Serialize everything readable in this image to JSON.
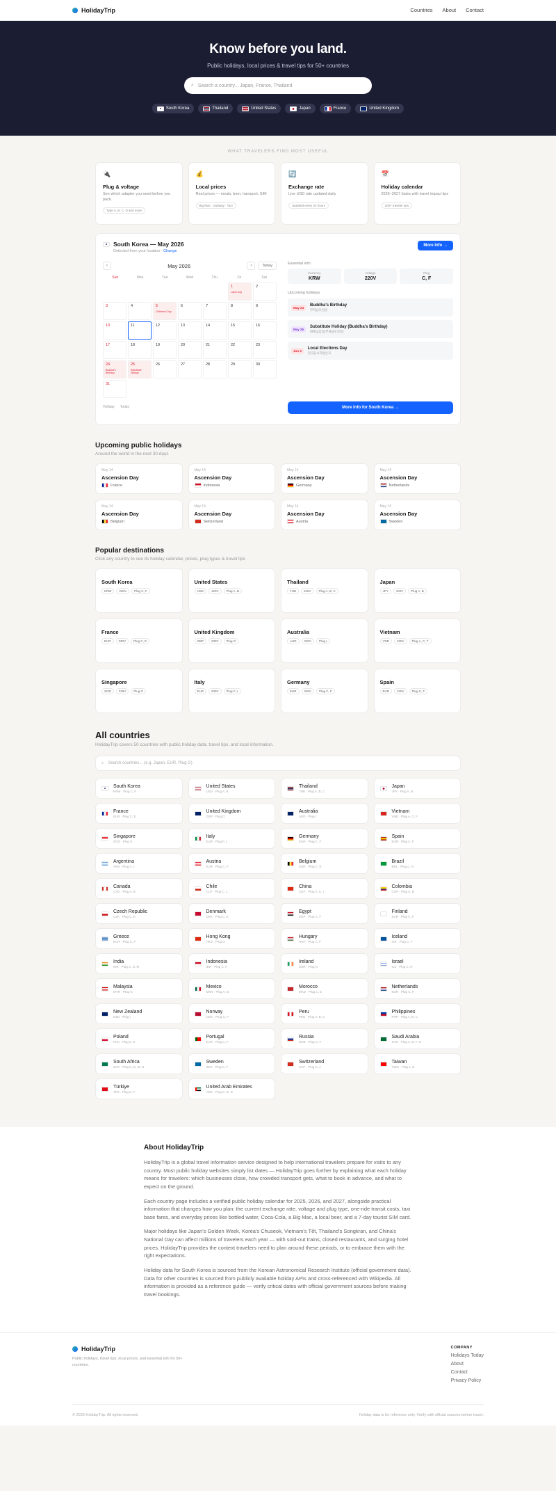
{
  "nav": {
    "brand": "HolidayTrip",
    "links": [
      "Countries",
      "About",
      "Contact"
    ]
  },
  "hero": {
    "title": "Know before you land.",
    "subtitle": "Public holidays, local prices & travel tips for 50+ countries",
    "search_placeholder": "Search a country... Japan, France, Thailand",
    "chips": [
      {
        "label": "South Korea",
        "flag": "kr"
      },
      {
        "label": "Thailand",
        "flag": "th"
      },
      {
        "label": "United States",
        "flag": "us"
      },
      {
        "label": "Japan",
        "flag": "jp"
      },
      {
        "label": "France",
        "flag": "fr"
      },
      {
        "label": "United Kingdom",
        "flag": "gb"
      }
    ]
  },
  "features": {
    "kicker": "WHAT TRAVELERS FIND MOST USEFUL",
    "items": [
      {
        "icon": "plug-icon",
        "glyph": "🔌",
        "title": "Plug & voltage",
        "desc": "See which adapter you need before you pack.",
        "tag": "Type A, B, C, D and more"
      },
      {
        "icon": "moneybag-icon",
        "glyph": "💰",
        "title": "Local prices",
        "desc": "Real prices — meals, beer, transport, SIM",
        "tag": "Big Mac · Subway · Taxi"
      },
      {
        "icon": "exchange-icon",
        "glyph": "🔄",
        "title": "Exchange rate",
        "desc": "Live USD rate updated daily",
        "tag": "Updated every 24 hours"
      },
      {
        "icon": "calendar-icon",
        "glyph": "📅",
        "title": "Holiday calendar",
        "desc": "2025–2027 dates with travel impact tips",
        "tag": "100+ traveler tips"
      }
    ]
  },
  "calendar": {
    "title": "South Korea — May 2026",
    "detected": "Detected from your location · ",
    "change": "Change",
    "more_btn": "More Info →",
    "month": "May 2026",
    "today": "Today",
    "dow": [
      "Sun",
      "Mon",
      "Tue",
      "Wed",
      "Thu",
      "Fri",
      "Sat"
    ],
    "legend_holiday": "Holiday",
    "legend_today": "Today",
    "essential_label": "Essential info",
    "currency_k": "Currency",
    "currency_v": "KRW",
    "voltage_k": "Voltage",
    "voltage_v": "220V",
    "plug_k": "Plug",
    "plug_v": "C, F",
    "upcoming_label": "Upcoming holidays",
    "upcoming": [
      {
        "date": "May 24",
        "name": "Buddha's Birthday",
        "local": "부처님오신날",
        "bg": "#fde3e3",
        "fg": "#d23"
      },
      {
        "date": "May 25",
        "name": "Substitute Holiday (Buddha's Birthday)",
        "local": "대체공휴일(부처님오신날)",
        "bg": "#eee3fd",
        "fg": "#7a3bd1"
      },
      {
        "date": "Jun 3",
        "name": "Local Elections Day",
        "local": "전국동시지방선거",
        "bg": "#fde3e3",
        "fg": "#d23"
      }
    ],
    "cta": "More Info for South Korea →"
  },
  "holidays": {
    "title": "Upcoming public holidays",
    "subtitle": "Around the world in the next 30 days",
    "items": [
      {
        "date": "May 14",
        "name": "Ascension Day",
        "country": "France",
        "flag": "fr"
      },
      {
        "date": "May 14",
        "name": "Ascension Day",
        "country": "Indonesia",
        "flag": "id"
      },
      {
        "date": "May 14",
        "name": "Ascension Day",
        "country": "Germany",
        "flag": "de"
      },
      {
        "date": "May 14",
        "name": "Ascension Day",
        "country": "Netherlands",
        "flag": "nl"
      },
      {
        "date": "May 14",
        "name": "Ascension Day",
        "country": "Belgium",
        "flag": "be"
      },
      {
        "date": "May 14",
        "name": "Ascension Day",
        "country": "Switzerland",
        "flag": "ch"
      },
      {
        "date": "May 14",
        "name": "Ascension Day",
        "country": "Austria",
        "flag": "at"
      },
      {
        "date": "May 14",
        "name": "Ascension Day",
        "country": "Sweden",
        "flag": "se"
      }
    ]
  },
  "popular": {
    "title": "Popular destinations",
    "subtitle": "Click any country to see its holiday calendar, prices, plug types & travel tips",
    "items": [
      {
        "name": "South Korea",
        "flag": "kr",
        "tags": [
          "KRW",
          "220V",
          "Plug C, F"
        ]
      },
      {
        "name": "United States",
        "flag": "us",
        "tags": [
          "USD",
          "120V",
          "Plug A, B"
        ]
      },
      {
        "name": "Thailand",
        "flag": "th",
        "tags": [
          "THB",
          "220V",
          "Plug A, B, C"
        ]
      },
      {
        "name": "Japan",
        "flag": "jp",
        "tags": [
          "JPY",
          "100V",
          "Plug A, B"
        ]
      },
      {
        "name": "France",
        "flag": "fr",
        "tags": [
          "EUR",
          "230V",
          "Plug C, E"
        ]
      },
      {
        "name": "United Kingdom",
        "flag": "gb",
        "tags": [
          "GBP",
          "230V",
          "Plug G"
        ]
      },
      {
        "name": "Australia",
        "flag": "au",
        "tags": [
          "AUD",
          "230V",
          "Plug I"
        ]
      },
      {
        "name": "Vietnam",
        "flag": "vn",
        "tags": [
          "VND",
          "220V",
          "Plug A, C, F"
        ]
      },
      {
        "name": "Singapore",
        "flag": "sg",
        "tags": [
          "SGD",
          "230V",
          "Plug G"
        ]
      },
      {
        "name": "Italy",
        "flag": "it",
        "tags": [
          "EUR",
          "230V",
          "Plug F, L"
        ]
      },
      {
        "name": "Germany",
        "flag": "de",
        "tags": [
          "EUR",
          "230V",
          "Plug C, F"
        ]
      },
      {
        "name": "Spain",
        "flag": "es",
        "tags": [
          "EUR",
          "230V",
          "Plug C, F"
        ]
      }
    ]
  },
  "all": {
    "title": "All countries",
    "subtitle": "HolidayTrip covers 50 countries with public holiday data, travel tips, and local information.",
    "search_placeholder": "Search countries... (e.g. Japan, EUR, Plug G)",
    "items": [
      {
        "name": "South Korea",
        "meta": "KRW · Plug C, F",
        "flag": "kr"
      },
      {
        "name": "United States",
        "meta": "USD · Plug A, B",
        "flag": "us"
      },
      {
        "name": "Thailand",
        "meta": "THB · Plug A, B, C",
        "flag": "th"
      },
      {
        "name": "Japan",
        "meta": "JPY · Plug A, B",
        "flag": "jp"
      },
      {
        "name": "France",
        "meta": "EUR · Plug C, E",
        "flag": "fr"
      },
      {
        "name": "United Kingdom",
        "meta": "GBP · Plug G",
        "flag": "gb"
      },
      {
        "name": "Australia",
        "meta": "AUD · Plug I",
        "flag": "au"
      },
      {
        "name": "Vietnam",
        "meta": "VND · Plug A, C, F",
        "flag": "vn"
      },
      {
        "name": "Singapore",
        "meta": "SGD · Plug G",
        "flag": "sg"
      },
      {
        "name": "Italy",
        "meta": "EUR · Plug F, L",
        "flag": "it"
      },
      {
        "name": "Germany",
        "meta": "EUR · Plug C, F",
        "flag": "de"
      },
      {
        "name": "Spain",
        "meta": "EUR · Plug C, F",
        "flag": "es"
      },
      {
        "name": "Argentina",
        "meta": "ARS · Plug C, I",
        "flag": "ar"
      },
      {
        "name": "Austria",
        "meta": "EUR · Plug C, F",
        "flag": "at"
      },
      {
        "name": "Belgium",
        "meta": "EUR · Plug C, E",
        "flag": "be"
      },
      {
        "name": "Brazil",
        "meta": "BRL · Plug C, N",
        "flag": "br"
      },
      {
        "name": "Canada",
        "meta": "CAD · Plug A, B",
        "flag": "ca"
      },
      {
        "name": "Chile",
        "meta": "CLP · Plug C, L",
        "flag": "cl"
      },
      {
        "name": "China",
        "meta": "CNY · Plug A, C, I",
        "flag": "cn"
      },
      {
        "name": "Colombia",
        "meta": "COP · Plug A, B",
        "flag": "co"
      },
      {
        "name": "Czech Republic",
        "meta": "CZK · Plug C, E",
        "flag": "cz"
      },
      {
        "name": "Denmark",
        "meta": "DKK · Plug C, K",
        "flag": "dk"
      },
      {
        "name": "Egypt",
        "meta": "EGP · Plug C, F",
        "flag": "eg"
      },
      {
        "name": "Finland",
        "meta": "EUR · Plug C, F",
        "flag": "fi"
      },
      {
        "name": "Greece",
        "meta": "EUR · Plug C, F",
        "flag": "gr"
      },
      {
        "name": "Hong Kong",
        "meta": "HKD · Plug G",
        "flag": "hk"
      },
      {
        "name": "Hungary",
        "meta": "HUF · Plug C, F",
        "flag": "hu"
      },
      {
        "name": "Iceland",
        "meta": "ISK · Plug C, F",
        "flag": "is"
      },
      {
        "name": "India",
        "meta": "INR · Plug C, D, M",
        "flag": "in"
      },
      {
        "name": "Indonesia",
        "meta": "IDR · Plug C, F",
        "flag": "id"
      },
      {
        "name": "Ireland",
        "meta": "EUR · Plug G",
        "flag": "ie"
      },
      {
        "name": "Israel",
        "meta": "ILS · Plug C, H",
        "flag": "il"
      },
      {
        "name": "Malaysia",
        "meta": "MYR · Plug G",
        "flag": "my"
      },
      {
        "name": "Mexico",
        "meta": "MXN · Plug A, B",
        "flag": "mx"
      },
      {
        "name": "Morocco",
        "meta": "MAD · Plug C, E",
        "flag": "ma"
      },
      {
        "name": "Netherlands",
        "meta": "EUR · Plug C, F",
        "flag": "nl"
      },
      {
        "name": "New Zealand",
        "meta": "NZD · Plug I",
        "flag": "nz"
      },
      {
        "name": "Norway",
        "meta": "NOK · Plug C, F",
        "flag": "no"
      },
      {
        "name": "Peru",
        "meta": "PEN · Plug A, B, C",
        "flag": "pe"
      },
      {
        "name": "Philippines",
        "meta": "PHP · Plug A, B, C",
        "flag": "ph"
      },
      {
        "name": "Poland",
        "meta": "PLN · Plug C, E",
        "flag": "pl"
      },
      {
        "name": "Portugal",
        "meta": "EUR · Plug C, F",
        "flag": "pt"
      },
      {
        "name": "Russia",
        "meta": "RUB · Plug C, F",
        "flag": "ru"
      },
      {
        "name": "Saudi Arabia",
        "meta": "SAR · Plug A, B, F, G",
        "flag": "sa"
      },
      {
        "name": "South Africa",
        "meta": "ZAR · Plug C, D, M, N",
        "flag": "za"
      },
      {
        "name": "Sweden",
        "meta": "SEK · Plug C, F",
        "flag": "se"
      },
      {
        "name": "Switzerland",
        "meta": "CHF · Plug C, J",
        "flag": "ch"
      },
      {
        "name": "Taiwan",
        "meta": "TWD · Plug A, B",
        "flag": "tw"
      },
      {
        "name": "Türkiye",
        "meta": "TRY · Plug C, F",
        "flag": "tr"
      },
      {
        "name": "United Arab Emirates",
        "meta": "AED · Plug C, D, G",
        "flag": "ae"
      }
    ]
  },
  "about": {
    "title": "About HolidayTrip",
    "paragraphs": [
      "HolidayTrip is a global travel information service designed to help international travelers prepare for visits to any country. Most public holiday websites simply list dates — HolidayTrip goes further by explaining what each holiday means for travelers: which businesses close, how crowded transport gets, what to book in advance, and what to expect on the ground.",
      "Each country page includes a verified public holiday calendar for 2025, 2026, and 2027, alongside practical information that changes how you plan: the current exchange rate, voltage and plug type, one-ride transit costs, taxi base fares, and everyday prices like bottled water, Coca-Cola, a Big Mac, a local beer, and a 7-day tourist SIM card.",
      "Major holidays like Japan's Golden Week, Korea's Chuseok, Vietnam's Tết, Thailand's Songkran, and China's National Day can affect millions of travelers each year — with sold-out trains, closed restaurants, and surging hotel prices. HolidayTrip provides the context travelers need to plan around these periods, or to embrace them with the right expectations.",
      "Holiday data for South Korea is sourced from the Korean Astronomical Research Institute (official government data). Data for other countries is sourced from publicly available holiday APIs and cross-referenced with Wikipedia. All information is provided as a reference guide — verify critical dates with official government sources before making travel bookings."
    ]
  },
  "footer": {
    "brand": "HolidayTrip",
    "desc": "Public holidays, travel tips, local prices, and essential info for 50+ countries.",
    "company": "COMPANY",
    "links": [
      "Holidays Today",
      "About",
      "Contact",
      "Privacy Policy"
    ],
    "copyright": "© 2026 HolidayTrip. All rights reserved.",
    "disclaimer": "Holiday data is for reference only. Verify with official sources before travel."
  }
}
